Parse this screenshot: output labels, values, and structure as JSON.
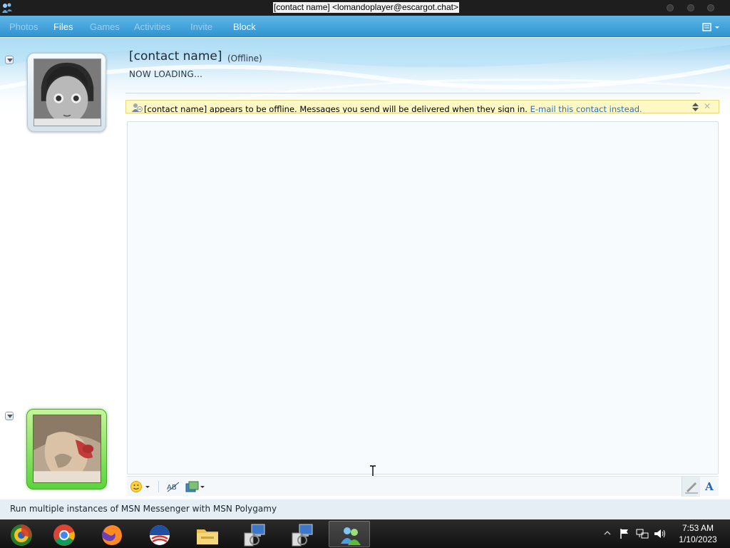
{
  "window": {
    "title": "[contact name] <lomandoplayer@escargot.chat>"
  },
  "menu": {
    "photos": "Photos",
    "files": "Files",
    "games": "Games",
    "activities": "Activities",
    "invite": "Invite",
    "block": "Block"
  },
  "contact": {
    "name": "[contact name]",
    "status": "(Offline)",
    "personal_message": "NOW LOADING..."
  },
  "infobar": {
    "message": "[contact name] appears to be offline. Messages you send will be delivered when they sign in.",
    "link": "E-mail this contact instead."
  },
  "statusbar": {
    "text": "Run multiple instances of MSN Messenger with MSN Polygamy"
  },
  "taskbar": {
    "apps": [
      "start-orb",
      "chrome",
      "firefox",
      "obama-logo",
      "file-explorer",
      "network-tool-1",
      "network-tool-2",
      "windows-live-messenger"
    ],
    "active_app": "windows-live-messenger",
    "time": "7:53 AM",
    "date": "1/10/2023"
  },
  "colors": {
    "menubar": "#3fa2dc",
    "infobar": "#fdf8c4",
    "link": "#2a6fc0",
    "self_frame": "#5bd43b"
  }
}
